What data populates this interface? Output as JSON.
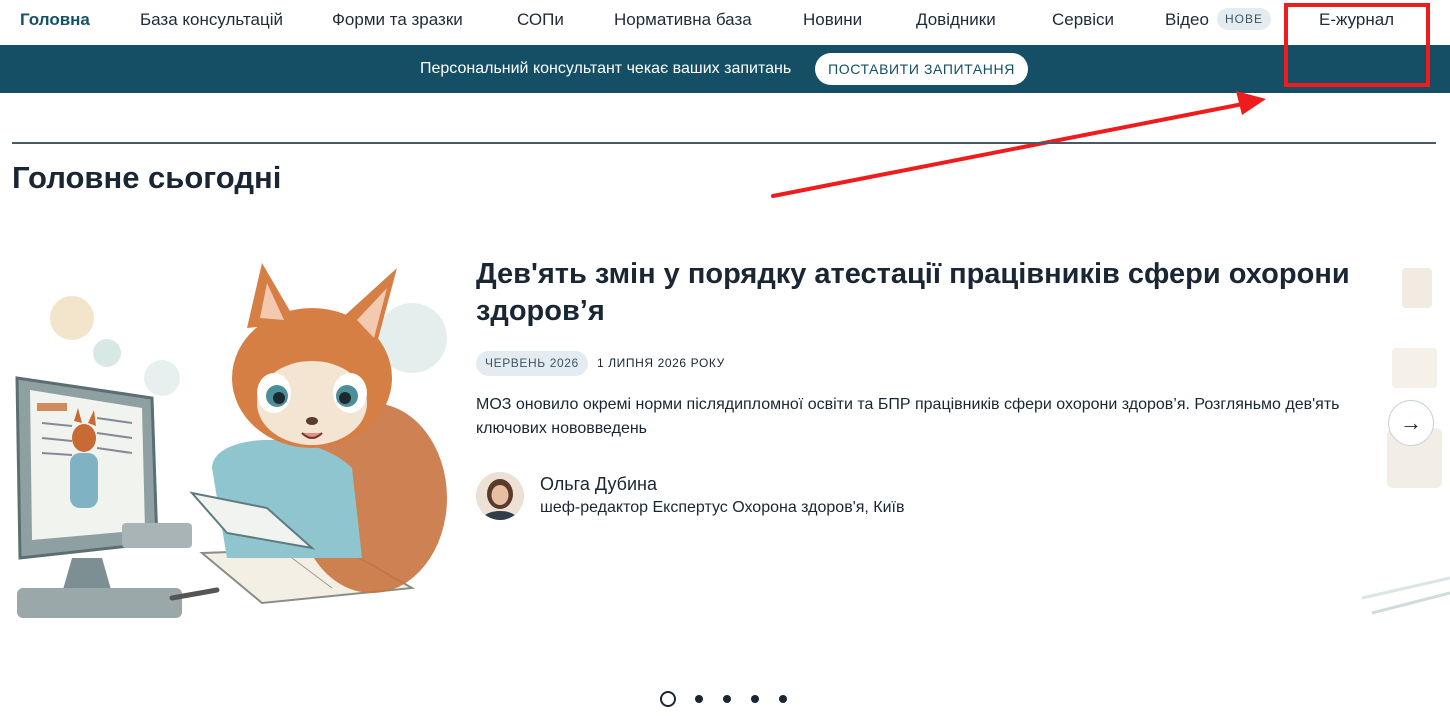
{
  "nav": {
    "items": [
      "Головна",
      "База консультацій",
      "Форми та зразки",
      "СОПи",
      "Нормативна база",
      "Новини",
      "Довідники",
      "Сервіси",
      "Відео",
      "Е-журнал"
    ],
    "badge": "НОВЕ",
    "active_index": 0
  },
  "banner": {
    "text": "Персональний консультант чекає ваших запитань",
    "button": "ПОСТАВИТИ ЗАПИТАННЯ"
  },
  "section": {
    "title": "Головне сьогодні"
  },
  "article": {
    "title": "Дев'ять змін у порядку атестації працівників сфери охорони здоров’я",
    "tag": "ЧЕРВЕНЬ 2026",
    "date": "1 ЛИПНЯ 2026 РОКУ",
    "lead": "МОЗ оновило окремі норми післядипломної освіти та БПР працівників сфери охорони здоров’я. Розгляньмо дев'ять ключових нововведень",
    "author": {
      "name": "Ольга Дубина",
      "role": "шеф-редактор Експертус Охорона здоров'я, Київ"
    }
  },
  "carousel": {
    "next_glyph": "→",
    "slides": 5,
    "active_slide": 0
  },
  "colors": {
    "brand": "#144f66",
    "highlight": "#ee1c1c",
    "text": "#1a2633"
  }
}
